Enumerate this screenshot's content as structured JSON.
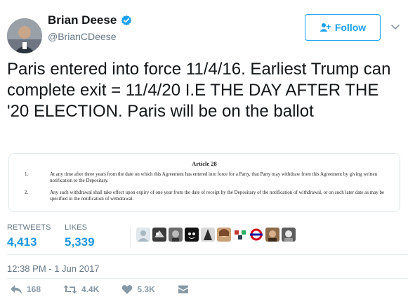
{
  "author": {
    "display_name": "Brian Deese",
    "handle": "@BrianCDeese",
    "verified": true
  },
  "follow_button": {
    "label": "Follow"
  },
  "tweet": {
    "text": "Paris entered into force 11/4/16. Earliest Trump can complete exit = 11/4/20 I.E THE DAY AFTER THE '20 ELECTION. Paris will be on the ballot"
  },
  "media": {
    "title": "Article 28",
    "items": [
      {
        "num": "1.",
        "text": "At any time after three years from the date on which this Agreement has entered into force for a Party, that Party may withdraw from this Agreement by giving written notification to the Depositary."
      },
      {
        "num": "2.",
        "text": "Any such withdrawal shall take effect upon expiry of one year from the date of receipt by the Depositary of the notification of withdrawal, or on such later date as may be specified in the notification of withdrawal."
      }
    ]
  },
  "stats": {
    "retweets_label": "RETWEETS",
    "retweets_value": "4,413",
    "likes_label": "LIKES",
    "likes_value": "5,339"
  },
  "timestamp": "12:38 PM - 1 Jun 2017",
  "actions": {
    "reply_count": "168",
    "retweet_count": "4.4K",
    "like_count": "5.3K"
  },
  "colors": {
    "accent": "#1da1f2",
    "link": "#1b95e0",
    "muted": "#657786",
    "icon": "#8899a6"
  }
}
